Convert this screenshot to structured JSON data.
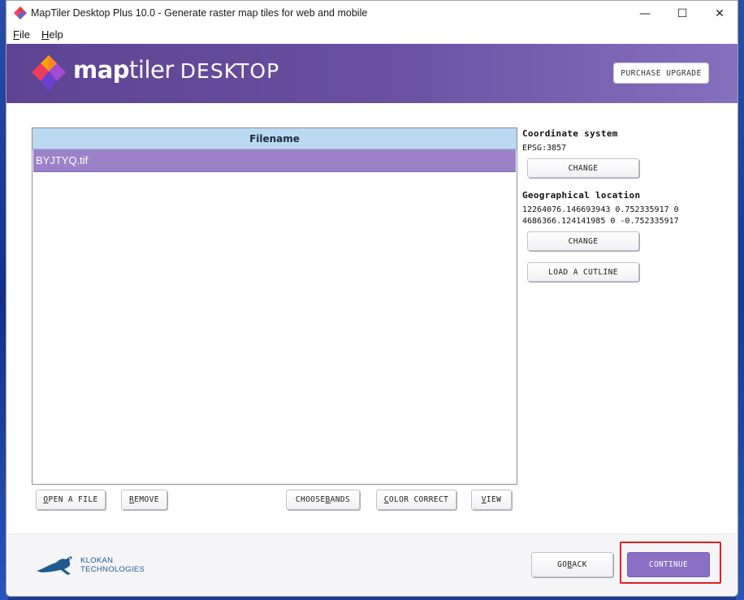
{
  "window": {
    "title": "MapTiler Desktop Plus 10.0 - Generate raster map tiles for web and mobile",
    "minimize_glyph": "—",
    "maximize_glyph": "☐",
    "close_glyph": "✕"
  },
  "menu": {
    "file_ul": "F",
    "file_rest": "ile",
    "help_ul": "H",
    "help_rest": "elp"
  },
  "banner": {
    "logo_bold": "map",
    "logo_light": "tiler",
    "logo_desktop": "DESKTOP",
    "purchase_label": "PURCHASE UPGRADE"
  },
  "file_table": {
    "header": "Filename",
    "rows": [
      "BYJTYQ.tif"
    ],
    "selected_row_color": "#9b82c8"
  },
  "side_panel": {
    "coord_heading": "Coordinate system",
    "coord_value": "EPSG:3857",
    "coord_change_label": "CHANGE",
    "geo_heading": "Geographical location",
    "geo_line1": "12264076.146693943 0.752335917 0",
    "geo_line2": "4686366.124141985 0 -0.752335917",
    "geo_change_label": "CHANGE",
    "cutline_label": "LOAD A CUTLINE"
  },
  "toolbar": {
    "open_ul": "O",
    "open_rest": "PEN A FILE",
    "remove_ul": "R",
    "remove_rest": "EMOVE",
    "bands_pre": "CHOOSE ",
    "bands_ul": "B",
    "bands_rest": "ANDS",
    "color_ul": "C",
    "color_rest": "OLOR CORRECT",
    "view_ul": "V",
    "view_rest": "IEW"
  },
  "footer": {
    "klokan_line1": "KLOKAN",
    "klokan_line2": "TECHNOLOGIES",
    "back_pre": "GO ",
    "back_ul": "B",
    "back_rest": "ACK",
    "continue_label": "CONTINUE"
  },
  "colors": {
    "brand_purple": "#6a4fa0",
    "accent_purple": "#8a6fc4",
    "highlight_red": "#e02020",
    "header_blue": "#bcd9f2"
  }
}
